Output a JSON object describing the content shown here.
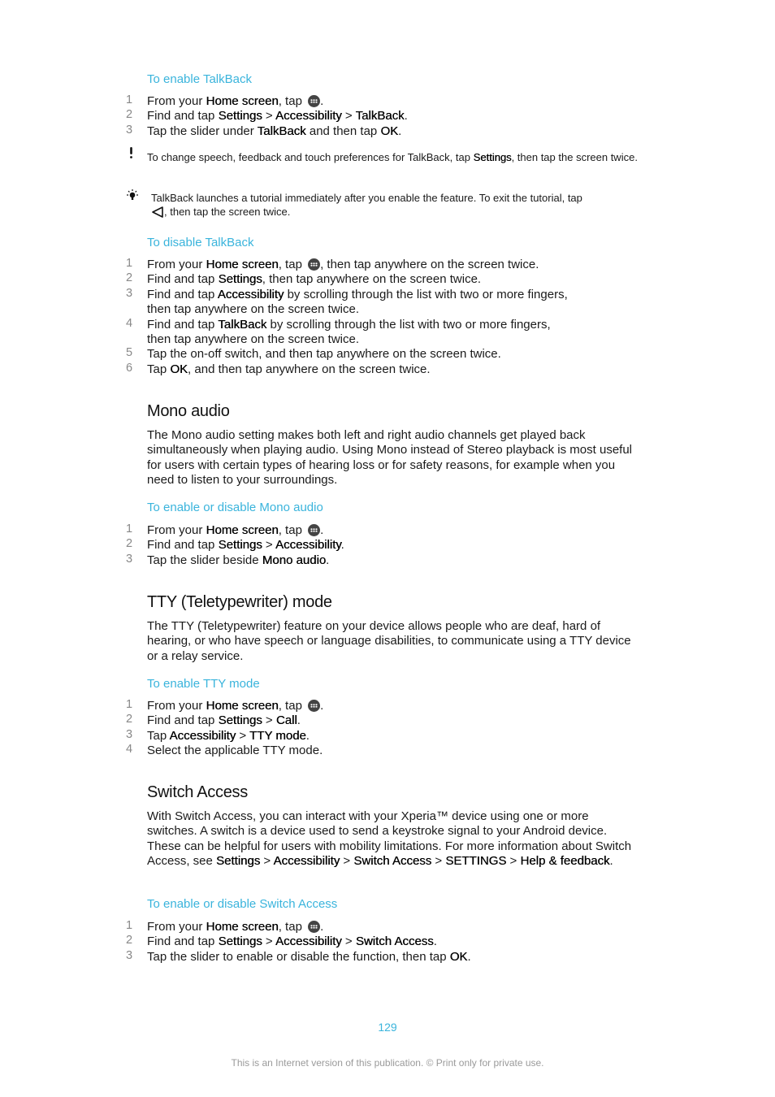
{
  "colors": {
    "accent": "#3ab4dc",
    "text": "#1a1a1a",
    "step_number": "#888888",
    "footer": "#9a9a9a"
  },
  "icons": {
    "menu": "apps-grid-icon",
    "warning": "exclamation-icon",
    "tip": "lightbulb-icon",
    "back": "back-triangle-icon"
  },
  "talkback_enable": {
    "title": "To enable TalkBack",
    "steps": [
      {
        "n": "1",
        "parts": [
          "From your ",
          "Home screen",
          ", tap ",
          "."
        ]
      },
      {
        "n": "2",
        "parts": [
          "Find and tap ",
          "Settings",
          " > ",
          "Accessibility",
          " > ",
          "TalkBack",
          "."
        ]
      },
      {
        "n": "3",
        "parts": [
          "Tap the slider under ",
          "TalkBack",
          " and then tap ",
          "OK",
          "."
        ]
      }
    ],
    "warning_note": {
      "parts": [
        "To change speech, feedback and touch preferences for TalkBack, tap ",
        "Settings",
        ", then tap the screen twice."
      ]
    },
    "tip_note": {
      "line1": "TalkBack launches a tutorial immediately after you enable the feature. To exit the tutorial, tap",
      "line2": ", then tap the screen twice."
    }
  },
  "talkback_disable": {
    "title": "To disable TalkBack",
    "steps": [
      {
        "n": "1",
        "parts": [
          "From your ",
          "Home screen",
          ", tap ",
          ", then tap anywhere on the screen twice."
        ]
      },
      {
        "n": "2",
        "parts": [
          "Find and tap ",
          "Settings",
          ", then tap anywhere on the screen twice."
        ]
      },
      {
        "n": "3",
        "parts": [
          "Find and tap ",
          "Accessibility",
          " by scrolling through the list with two or more fingers,",
          "then tap anywhere on the screen twice."
        ]
      },
      {
        "n": "4",
        "parts": [
          "Find and tap ",
          "TalkBack",
          " by scrolling through the list with two or more fingers,",
          "then tap anywhere on the screen twice."
        ]
      },
      {
        "n": "5",
        "parts": [
          "Tap the on-off switch, and then tap anywhere on the screen twice."
        ]
      },
      {
        "n": "6",
        "parts": [
          "Tap ",
          "OK",
          ", and then tap anywhere on the screen twice."
        ]
      }
    ]
  },
  "mono_audio": {
    "heading": "Mono audio",
    "description": "The Mono audio setting makes both left and right audio channels get played back simultaneously when playing audio. Using Mono instead of Stereo playback is most useful for users with certain types of hearing loss or for safety reasons, for example when you need to listen to your surroundings.",
    "proc_title": "To enable or disable Mono audio",
    "steps": [
      {
        "n": "1",
        "parts": [
          "From your ",
          "Home screen",
          ", tap ",
          "."
        ]
      },
      {
        "n": "2",
        "parts": [
          "Find and tap ",
          "Settings",
          " > ",
          "Accessibility",
          "."
        ]
      },
      {
        "n": "3",
        "parts": [
          "Tap the slider beside ",
          "Mono audio",
          "."
        ]
      }
    ]
  },
  "tty": {
    "heading": "TTY (Teletypewriter) mode",
    "description": "The TTY (Teletypewriter) feature on your device allows people who are deaf, hard of hearing, or who have speech or language disabilities, to communicate using a TTY device or a relay service.",
    "proc_title": "To enable TTY mode",
    "steps": [
      {
        "n": "1",
        "parts": [
          "From your ",
          "Home screen",
          ", tap ",
          "."
        ]
      },
      {
        "n": "2",
        "parts": [
          "Find and tap ",
          "Settings",
          " > ",
          "Call",
          "."
        ]
      },
      {
        "n": "3",
        "parts": [
          "Tap ",
          "Accessibility",
          " > ",
          "TTY mode",
          "."
        ]
      },
      {
        "n": "4",
        "parts": [
          "Select the applicable TTY mode."
        ]
      }
    ]
  },
  "switch_access": {
    "heading": "Switch Access",
    "description_parts": [
      "With Switch Access, you can interact with your Xperia™ device using one or more switches. A switch is a device used to send a keystroke signal to your Android device. These can be helpful for users with mobility limitations. For more information about Switch Access, see ",
      "Settings",
      " > ",
      "Accessibility",
      " > ",
      "Switch Access",
      " > ",
      "SETTINGS",
      " > ",
      "Help & feedback",
      "."
    ],
    "proc_title": "To enable or disable Switch Access",
    "steps": [
      {
        "n": "1",
        "parts": [
          "From your ",
          "Home screen",
          ", tap ",
          "."
        ]
      },
      {
        "n": "2",
        "parts": [
          "Find and tap ",
          "Settings",
          " > ",
          "Accessibility",
          " > ",
          "Switch Access",
          "."
        ]
      },
      {
        "n": "3",
        "parts": [
          "Tap the slider to enable or disable the function, then tap ",
          "OK",
          "."
        ]
      }
    ]
  },
  "footer": {
    "page_number": "129",
    "notice": "This is an Internet version of this publication. © Print only for private use."
  }
}
